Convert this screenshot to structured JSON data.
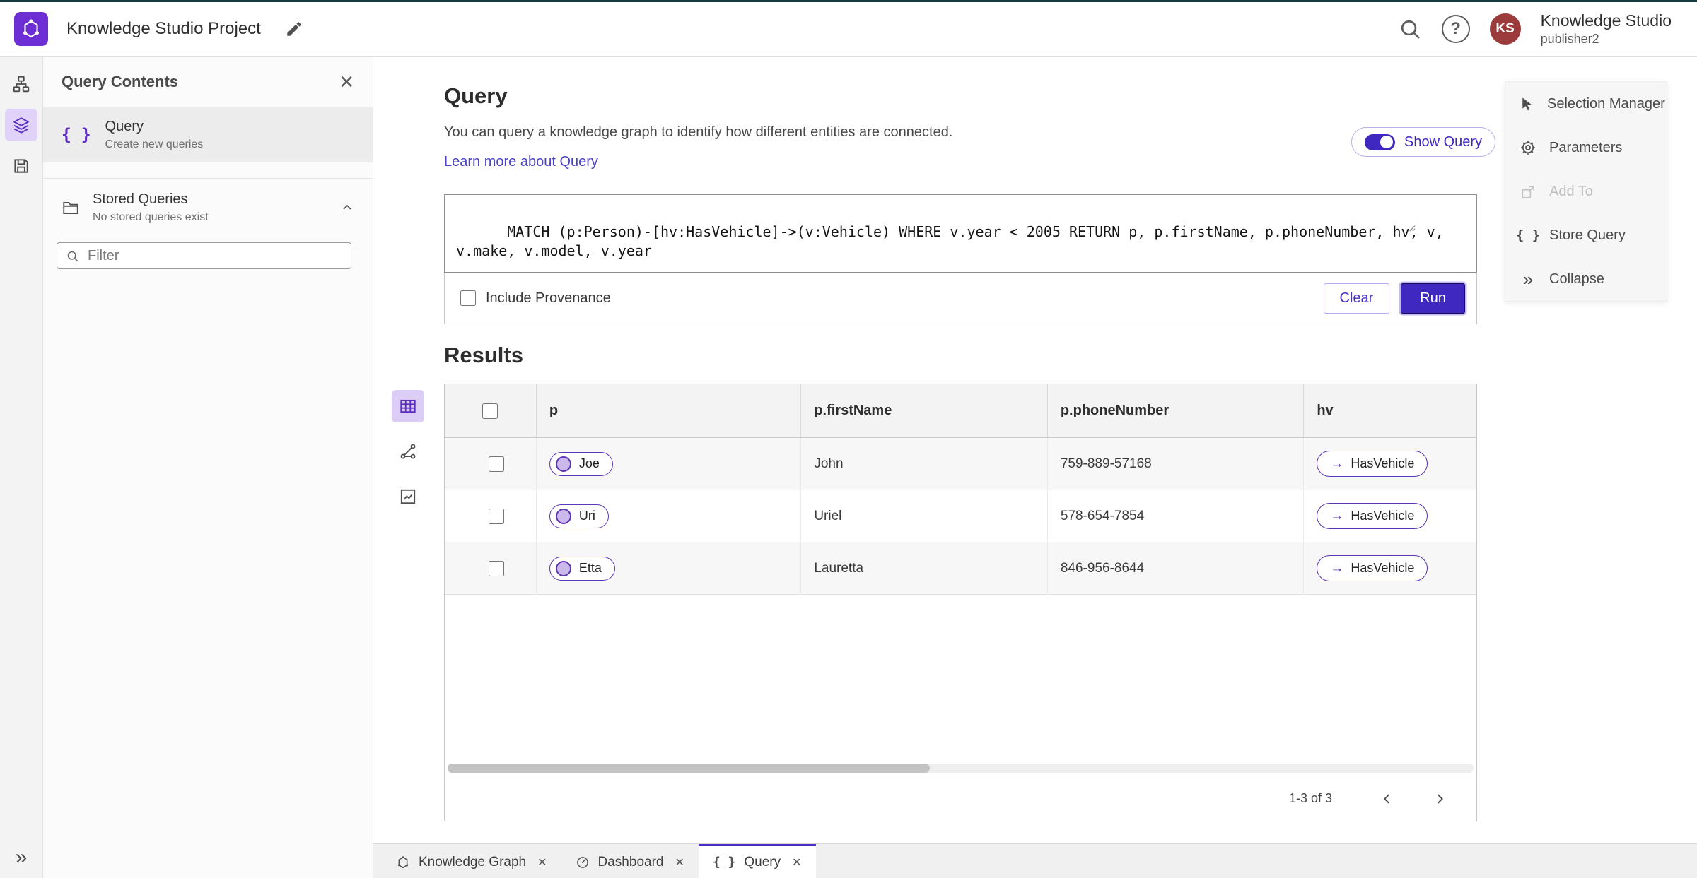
{
  "header": {
    "title": "Knowledge Studio Project",
    "app_name": "Knowledge Studio",
    "user_role": "publisher2",
    "avatar_initials": "KS",
    "help_glyph": "?"
  },
  "left_panel": {
    "title": "Query Contents",
    "query_item": {
      "label": "Query",
      "sublabel": "Create new queries"
    },
    "stored": {
      "label": "Stored Queries",
      "sublabel": "No stored queries exist"
    },
    "filter_placeholder": "Filter"
  },
  "query": {
    "title": "Query",
    "description": "You can query a knowledge graph to identify how different entities are connected.",
    "link": "Learn more about Query",
    "show_query_label": "Show Query",
    "text": "MATCH (p:Person)-[hv:HasVehicle]->(v:Vehicle) WHERE v.year < 2005 RETURN p, p.firstName, p.phoneNumber, hv, v, v.make, v.model, v.year",
    "include_provenance": "Include Provenance",
    "clear_label": "Clear",
    "run_label": "Run"
  },
  "results": {
    "title": "Results",
    "columns": [
      "p",
      "p.firstName",
      "p.phoneNumber",
      "hv"
    ],
    "rows": [
      {
        "p": "Joe",
        "firstName": "John",
        "phone": "759-889-57168",
        "hv": "HasVehicle"
      },
      {
        "p": "Uri",
        "firstName": "Uriel",
        "phone": "578-654-7854",
        "hv": "HasVehicle"
      },
      {
        "p": "Etta",
        "firstName": "Lauretta",
        "phone": "846-956-8644",
        "hv": "HasVehicle"
      }
    ],
    "pagination": "1-3 of 3"
  },
  "right_menu": {
    "items": [
      {
        "label": "Selection Manager",
        "disabled": false
      },
      {
        "label": "Parameters",
        "disabled": false
      },
      {
        "label": "Add To",
        "disabled": true
      },
      {
        "label": "Store Query",
        "disabled": false
      },
      {
        "label": "Collapse",
        "disabled": false
      }
    ]
  },
  "tabs": [
    {
      "label": "Knowledge Graph",
      "active": false
    },
    {
      "label": "Dashboard",
      "active": false
    },
    {
      "label": "Query",
      "active": true
    }
  ],
  "colors": {
    "accent": "#3f28c0",
    "entity_purple": "#5d34b5",
    "link": "#4a42c6",
    "avatar_bg": "#9b3b3b"
  }
}
